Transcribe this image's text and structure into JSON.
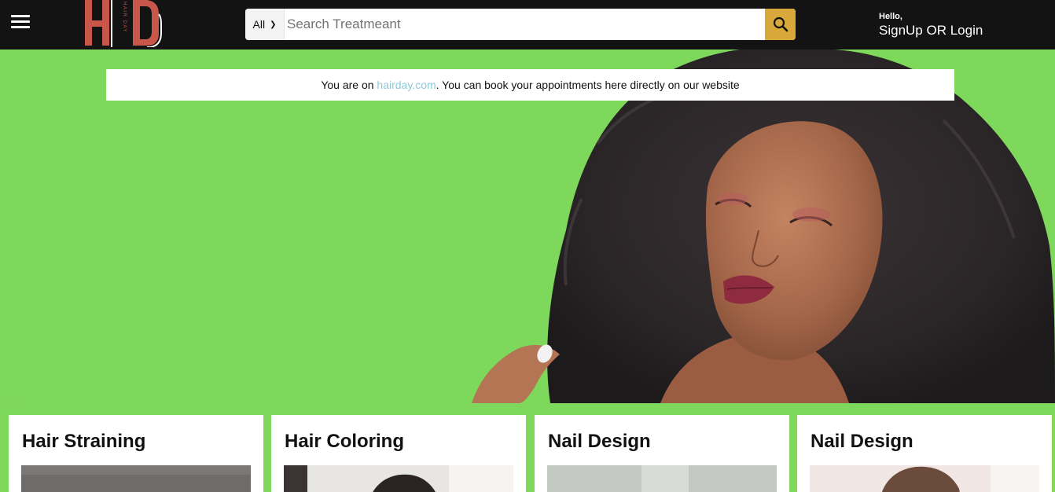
{
  "header": {
    "logo": {
      "letters": "HD",
      "tagline": "HAIR DAY"
    },
    "search": {
      "category": "All",
      "placeholder": "Search Treatmeant"
    },
    "account": {
      "greeting": "Hello,",
      "action": "SignUp OR Login"
    }
  },
  "notice": {
    "prefix": "You are on ",
    "link": "hairday.com",
    "suffix": ". You can book your appointments here directly on our website"
  },
  "cards": [
    {
      "title": "Hair Straining"
    },
    {
      "title": "Hair Coloring"
    },
    {
      "title": "Nail Design"
    },
    {
      "title": "Nail Design"
    }
  ],
  "colors": {
    "header_bg": "#131313",
    "hero_green": "#7ed85b",
    "search_button": "#d8a93a",
    "logo_red": "#c9564a",
    "link": "#8fc9d8"
  }
}
